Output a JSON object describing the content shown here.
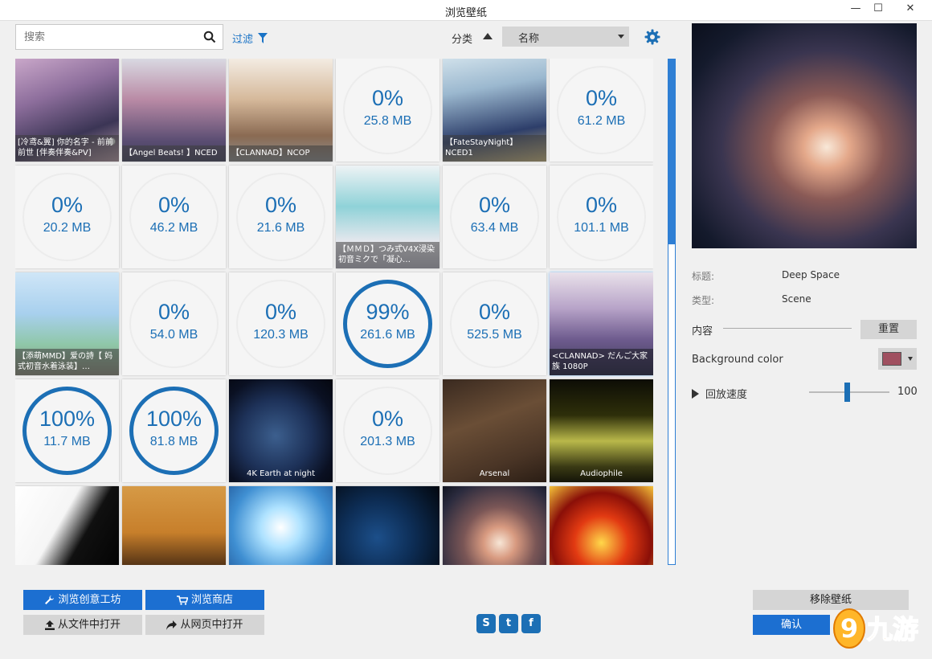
{
  "window": {
    "title": "浏览壁纸",
    "min_glyph": "—",
    "max_glyph": "☐",
    "close_glyph": "✕"
  },
  "toolbar": {
    "search_placeholder": "搜索",
    "filter_label": "过滤",
    "sort_label": "分类",
    "sort_value": "名称"
  },
  "tiles": [
    {
      "caption": "[冷鸢&翼] 你的名字 - 前前前世 [伴奏伴奏&PV]",
      "kind": "image"
    },
    {
      "caption": "【Angel Beats! 】NCED",
      "kind": "image"
    },
    {
      "caption": "【CLANNAD】NCOP",
      "kind": "image"
    },
    {
      "pct": "0%",
      "size": "25.8 MB",
      "kind": "download"
    },
    {
      "caption": "【FateStayNight】NCED1",
      "kind": "image"
    },
    {
      "pct": "0%",
      "size": "61.2 MB",
      "kind": "download"
    },
    {
      "pct": "0%",
      "size": "20.2 MB",
      "kind": "download"
    },
    {
      "pct": "0%",
      "size": "46.2 MB",
      "kind": "download"
    },
    {
      "pct": "0%",
      "size": "21.6 MB",
      "kind": "download"
    },
    {
      "caption": "【ＭＭＤ】つみ式V4X浸染初音ミクで「凝心…",
      "kind": "image"
    },
    {
      "pct": "0%",
      "size": "63.4 MB",
      "kind": "download"
    },
    {
      "pct": "0%",
      "size": "101.1 MB",
      "kind": "download"
    },
    {
      "caption": "【添萌MMD】爱の詩【 妈式初音水着泳装】…",
      "kind": "image"
    },
    {
      "pct": "0%",
      "size": "54.0 MB",
      "kind": "download"
    },
    {
      "pct": "0%",
      "size": "120.3 MB",
      "kind": "download"
    },
    {
      "pct": "99%",
      "size": "261.6 MB",
      "kind": "download-full"
    },
    {
      "pct": "0%",
      "size": "525.5 MB",
      "kind": "download"
    },
    {
      "caption": "<CLANNAD> だんご大家族 1080P",
      "kind": "image"
    },
    {
      "pct": "100%",
      "size": "11.7 MB",
      "kind": "download-full"
    },
    {
      "pct": "100%",
      "size": "81.8 MB",
      "kind": "download-full"
    },
    {
      "caption": "4K Earth at night",
      "kind": "image"
    },
    {
      "pct": "0%",
      "size": "201.3 MB",
      "kind": "download"
    },
    {
      "caption": "Arsenal",
      "kind": "image"
    },
    {
      "caption": "Audiophile",
      "kind": "image"
    },
    {
      "caption": "",
      "kind": "image"
    },
    {
      "caption": "",
      "kind": "image"
    },
    {
      "caption": "",
      "kind": "image"
    },
    {
      "caption": "",
      "kind": "image"
    },
    {
      "caption": "",
      "kind": "image"
    },
    {
      "caption": "",
      "kind": "image"
    }
  ],
  "details": {
    "title_label": "标题:",
    "title_value": "Deep Space",
    "type_label": "类型:",
    "type_value": "Scene",
    "content_label": "内容",
    "reset_button": "重置",
    "bg_color_label": "Background color",
    "bg_color_value": "#a05060",
    "speed_label": "回放速度",
    "speed_value": "100"
  },
  "bottom": {
    "workshop_button": "浏览创意工坊",
    "store_button": "浏览商店",
    "open_file_button": "从文件中打开",
    "open_web_button": "从网页中打开",
    "remove_button": "移除壁纸",
    "confirm_button": "确认"
  },
  "social": {
    "steam": "S",
    "twitter": "t",
    "facebook": "f"
  },
  "watermark": {
    "text": "九游",
    "digit": "9"
  }
}
